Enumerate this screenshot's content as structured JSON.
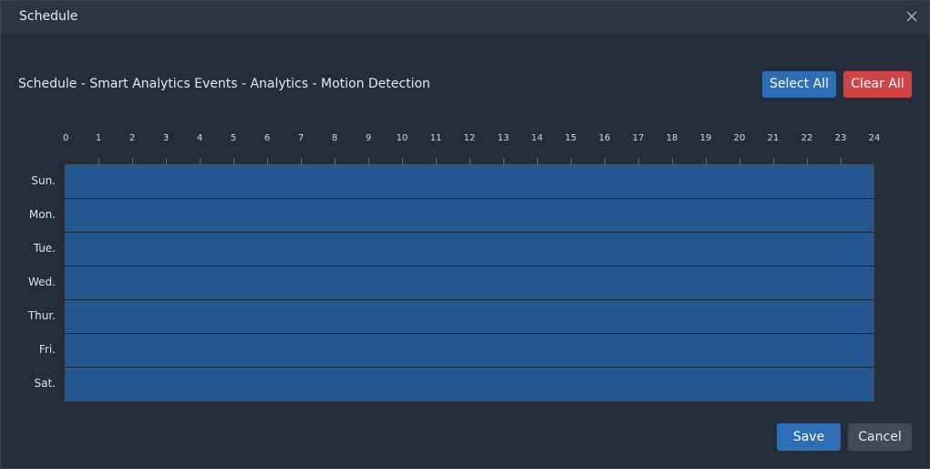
{
  "dialog": {
    "title": "Schedule",
    "close_icon": "close-icon"
  },
  "header": {
    "subtitle": "Schedule - Smart Analytics Events - Analytics - Motion Detection",
    "select_all_label": "Select All",
    "clear_all_label": "Clear All"
  },
  "schedule": {
    "hours": [
      "0",
      "1",
      "2",
      "3",
      "4",
      "5",
      "6",
      "7",
      "8",
      "9",
      "10",
      "11",
      "12",
      "13",
      "14",
      "15",
      "16",
      "17",
      "18",
      "19",
      "20",
      "21",
      "22",
      "23",
      "24"
    ],
    "days": [
      {
        "label": "Sun.",
        "selected_fraction": 1
      },
      {
        "label": "Mon.",
        "selected_fraction": 1
      },
      {
        "label": "Tue.",
        "selected_fraction": 1
      },
      {
        "label": "Wed.",
        "selected_fraction": 1
      },
      {
        "label": "Thur.",
        "selected_fraction": 1
      },
      {
        "label": "Fri.",
        "selected_fraction": 1
      },
      {
        "label": "Sat.",
        "selected_fraction": 1
      }
    ],
    "selected_color": "#22588f"
  },
  "footer": {
    "save_label": "Save",
    "cancel_label": "Cancel"
  },
  "colors": {
    "primary": "#2d6eb7",
    "danger": "#cf4545",
    "background": "#252d3a"
  }
}
